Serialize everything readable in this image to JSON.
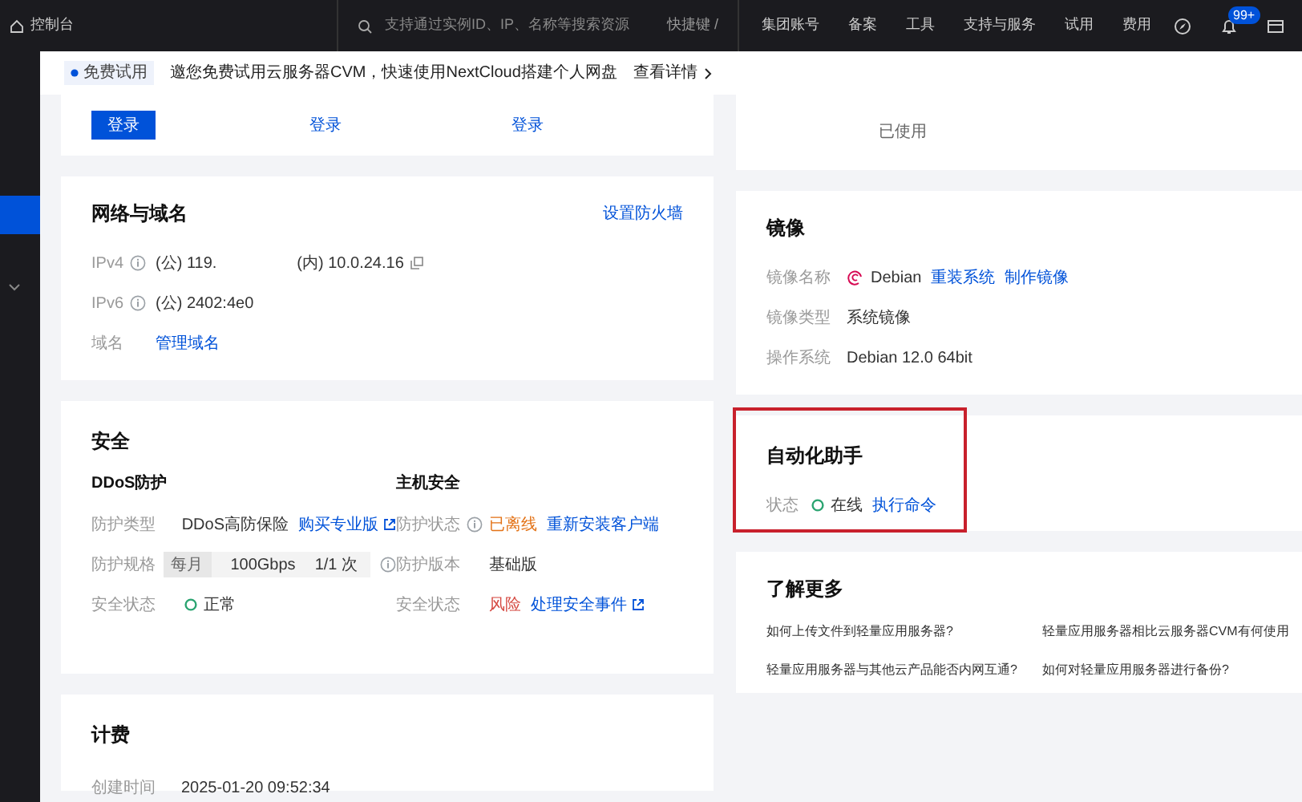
{
  "topbar": {
    "home_label": "控制台",
    "search_placeholder": "支持通过实例ID、IP、名称等搜索资源",
    "shortcut": "快捷键 /",
    "nav_items": [
      "集团账号",
      "备案",
      "工具",
      "支持与服务",
      "试用",
      "费用"
    ],
    "notification_badge": "99+"
  },
  "sidebar": {
    "items": [
      {
        "selected": true
      },
      {
        "selected": false
      }
    ]
  },
  "banner": {
    "tag": "免费试用",
    "text": "邀您免费试用云服务器CVM，快速使用NextCloud搭建个人网盘",
    "link": "查看详情"
  },
  "login_card": {
    "buttons": [
      {
        "label": "登录",
        "primary": true
      },
      {
        "label": "登录",
        "primary": false
      },
      {
        "label": "登录",
        "primary": false
      }
    ]
  },
  "usage_card": {
    "text": "已使用"
  },
  "network": {
    "title": "网络与域名",
    "action": "设置防火墙",
    "rows": [
      {
        "label": "IPv4",
        "info": true,
        "items": [
          {
            "kind": "text",
            "text": "(公) 119."
          },
          {
            "kind": "copy_text",
            "text": "(内) 10.0.24.16"
          }
        ]
      },
      {
        "label": "IPv6",
        "info": true,
        "items": [
          {
            "kind": "text",
            "text": "(公) 2402:4e0"
          }
        ]
      },
      {
        "label": "域名",
        "info": false,
        "items": [
          {
            "kind": "link",
            "text": "管理域名"
          }
        ]
      }
    ]
  },
  "image": {
    "title": "镜像",
    "rows": [
      {
        "label": "镜像名称",
        "info": false,
        "items": [
          {
            "kind": "logo_text",
            "text": "Debian"
          },
          {
            "kind": "link",
            "text": "重装系统"
          },
          {
            "kind": "link",
            "text": "制作镜像"
          }
        ]
      },
      {
        "label": "镜像类型",
        "info": false,
        "items": [
          {
            "kind": "text",
            "text": "系统镜像"
          }
        ]
      },
      {
        "label": "操作系统",
        "info": false,
        "items": [
          {
            "kind": "text",
            "text": "Debian 12.0 64bit"
          }
        ]
      }
    ]
  },
  "security": {
    "title": "安全",
    "sections": [
      {
        "heading": "DDoS防护",
        "rows": [
          {
            "label": "防护类型",
            "info": false,
            "items": [
              {
                "kind": "text",
                "text": "DDoS高防保险"
              },
              {
                "kind": "ext_link",
                "text": "购买专业版"
              }
            ]
          },
          {
            "label": "防护规格",
            "info": false,
            "items": [
              {
                "kind": "spec",
                "parts": [
                  "每月",
                  "100Gbps",
                  "1/1 次"
                ]
              },
              {
                "kind": "info"
              }
            ]
          },
          {
            "label": "安全状态",
            "info": false,
            "items": [
              {
                "kind": "status_ok",
                "text": "正常"
              }
            ]
          }
        ]
      },
      {
        "heading": "主机安全",
        "rows": [
          {
            "label": "防护状态",
            "info": true,
            "items": [
              {
                "kind": "warning",
                "text": "已离线"
              },
              {
                "kind": "link",
                "text": "重新安装客户端"
              }
            ]
          },
          {
            "label": "防护版本",
            "info": false,
            "items": [
              {
                "kind": "text",
                "text": "基础版"
              }
            ]
          },
          {
            "label": "安全状态",
            "info": false,
            "items": [
              {
                "kind": "danger",
                "text": "风险"
              },
              {
                "kind": "ext_link",
                "text": "处理安全事件"
              }
            ]
          }
        ]
      }
    ]
  },
  "automation": {
    "title": "自动化助手",
    "highlighted": true,
    "rows": [
      {
        "label": "状态",
        "info": false,
        "items": [
          {
            "kind": "status_ok",
            "text": "在线"
          },
          {
            "kind": "link",
            "text": "执行命令"
          }
        ]
      }
    ]
  },
  "learn_more": {
    "title": "了解更多",
    "links": [
      "如何上传文件到轻量应用服务器?",
      "轻量应用服务器相比云服务器CVM有何使用",
      "轻量应用服务器与其他云产品能否内网互通?",
      "如何对轻量应用服务器进行备份?"
    ]
  },
  "billing": {
    "title": "计费",
    "rows": [
      {
        "label": "创建时间",
        "info": false,
        "items": [
          {
            "kind": "text",
            "text": "2025-01-20 09:52:34"
          }
        ]
      }
    ]
  }
}
